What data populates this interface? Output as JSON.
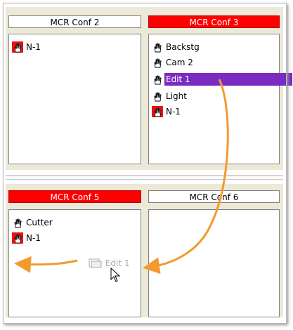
{
  "panels": [
    {
      "title": "MCR Conf 2",
      "highlight": false,
      "items": [
        {
          "label": "N-1",
          "icon": "red-hand-icon"
        }
      ]
    },
    {
      "title": "MCR Conf 3",
      "highlight": true,
      "items": [
        {
          "label": "Backstg",
          "icon": "hand-icon"
        },
        {
          "label": "Cam 2",
          "icon": "hand-icon"
        },
        {
          "label": "Edit 1",
          "icon": "hand-icon",
          "selected": true
        },
        {
          "label": "Light",
          "icon": "hand-icon"
        },
        {
          "label": "N-1",
          "icon": "red-hand-icon"
        }
      ]
    },
    {
      "title": "MCR Conf 5",
      "highlight": true,
      "items": [
        {
          "label": "Cutter",
          "icon": "hand-icon"
        },
        {
          "label": "N-1",
          "icon": "red-hand-icon"
        }
      ]
    },
    {
      "title": "MCR Conf 6",
      "highlight": false,
      "items": []
    }
  ],
  "drag": {
    "label": "Edit 1",
    "icon": "drag-ghost-icon"
  },
  "colors": {
    "header_red": "#ff0000",
    "selection": "#7a2bc2",
    "arrow": "#f29a2e"
  }
}
